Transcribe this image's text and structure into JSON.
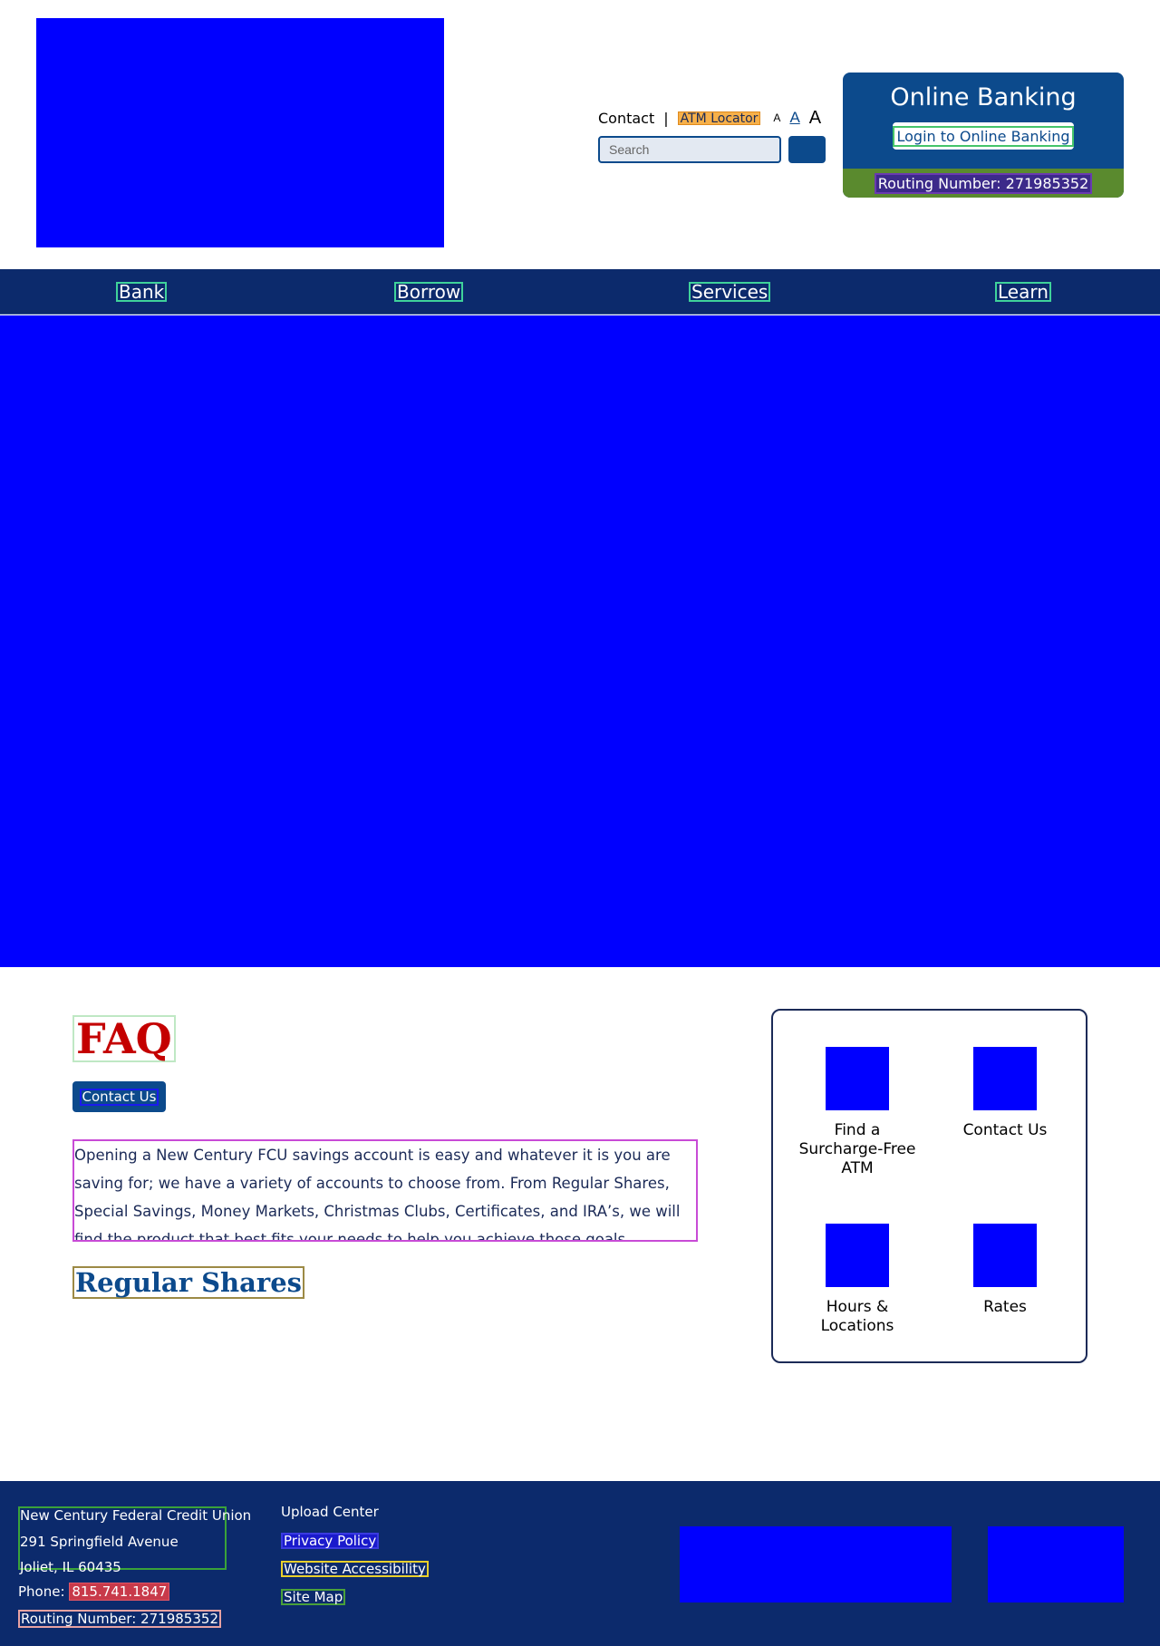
{
  "header": {
    "utility": {
      "contact": "Contact",
      "separator": "|",
      "atm_locator": "ATM Locator",
      "font_small": "A",
      "font_medium": "A",
      "font_large": "A"
    },
    "search": {
      "placeholder": "Search"
    },
    "online_banking": {
      "title": "Online Banking",
      "login": "Login to Online Banking",
      "routing": "Routing Number: 271985352"
    }
  },
  "nav": {
    "items": [
      {
        "label": "Bank"
      },
      {
        "label": "Borrow"
      },
      {
        "label": "Services"
      },
      {
        "label": "Learn"
      }
    ]
  },
  "main": {
    "title": "FAQ",
    "contact_button": "Contact Us",
    "intro": "Opening a New Century FCU savings account is easy and whatever it is you are saving for; we have a variety of accounts to choose from. From Regular Shares, Special Savings, Money Markets, Christmas Clubs, Certificates, and IRA’s, we will find the product that best fits your needs to help you achieve those goals.",
    "section_heading": "Regular Shares"
  },
  "quick_links": [
    {
      "label": "Find a Surcharge-Free ATM"
    },
    {
      "label": "Contact Us"
    },
    {
      "label": "Hours & Locations"
    },
    {
      "label": "Rates"
    }
  ],
  "footer": {
    "address": {
      "name": "New Century Federal Credit Union",
      "street": "291 Springfield Avenue",
      "city": "Joliet, IL 60435"
    },
    "phone_label": "Phone:",
    "phone": "815.741.1847",
    "routing": "Routing Number: 271985352",
    "links": {
      "upload": "Upload Center",
      "privacy": "Privacy Policy",
      "accessibility": "Website Accessibility",
      "sitemap": "Site Map"
    }
  },
  "colors": {
    "navy": "#0c2a6c",
    "brand_blue": "#0c4a8c",
    "green": "#5a8a2e",
    "faq_red": "#c40000",
    "placeholder_blue": "#0000ff"
  }
}
